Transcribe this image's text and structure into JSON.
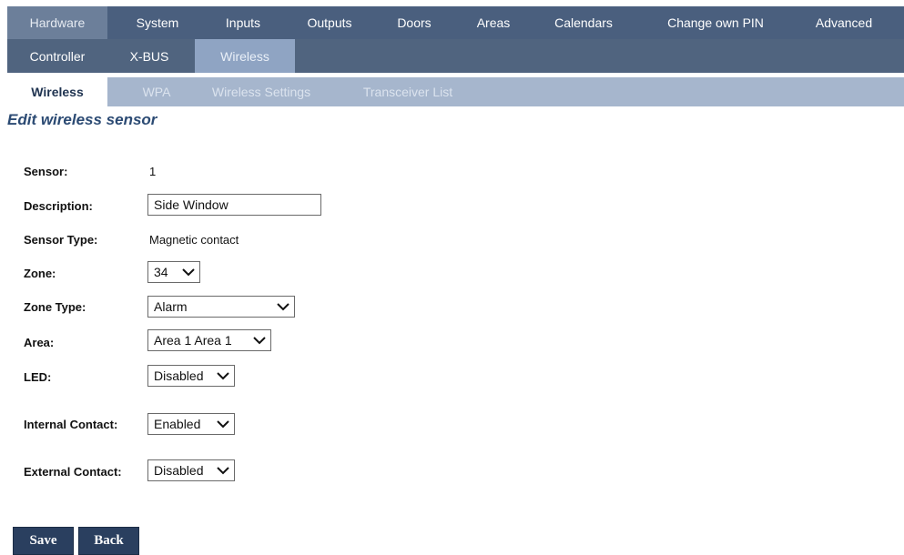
{
  "nav_main": [
    "Hardware",
    "System",
    "Inputs",
    "Outputs",
    "Doors",
    "Areas",
    "Calendars",
    "Change own PIN",
    "Advanced"
  ],
  "nav_sub": [
    "Controller",
    "X-BUS",
    "Wireless"
  ],
  "nav_third": [
    "Wireless",
    "WPA",
    "Wireless Settings",
    "Transceiver List"
  ],
  "page_title": "Edit wireless sensor",
  "form": {
    "sensor_label": "Sensor:",
    "sensor_value": "1",
    "description_label": "Description:",
    "description_value": "Side Window",
    "sensor_type_label": "Sensor Type:",
    "sensor_type_value": "Magnetic contact",
    "zone_label": "Zone:",
    "zone_value": "34",
    "zone_type_label": "Zone Type:",
    "zone_type_value": "Alarm",
    "area_label": "Area:",
    "area_value": "Area 1 Area 1",
    "led_label": "LED:",
    "led_value": "Disabled",
    "internal_label": "Internal Contact:",
    "internal_value": "Enabled",
    "external_label": "External Contact:",
    "external_value": "Disabled"
  },
  "buttons": {
    "save": "Save",
    "back": "Back"
  }
}
